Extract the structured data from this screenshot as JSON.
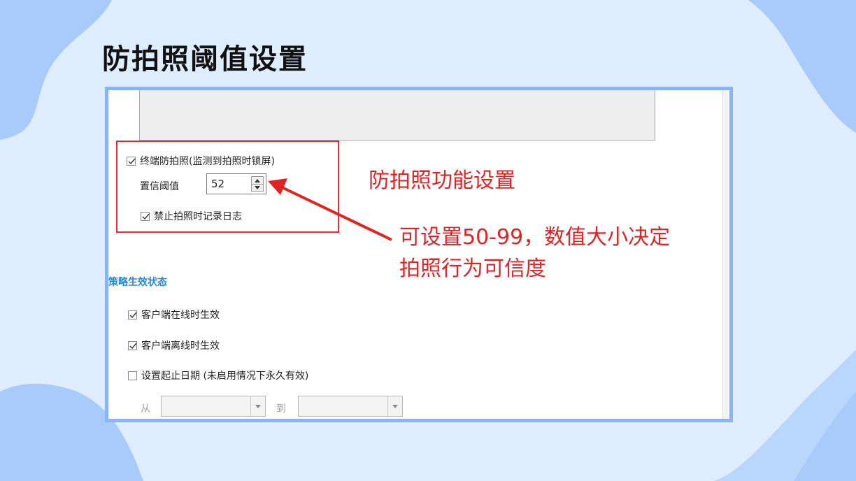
{
  "slide": {
    "title": "防拍照阈值设置"
  },
  "settings": {
    "terminal_anti_photo": {
      "label": "终端防拍照(监测到拍照时锁屏)",
      "checked": true
    },
    "confidence_threshold": {
      "label": "置信阈值",
      "value": "52"
    },
    "no_photo_log": {
      "label": "禁止拍照时记录日志",
      "checked": true
    }
  },
  "policy_status": {
    "section_title": "策略生效状态",
    "online": {
      "label": "客户端在线时生效",
      "checked": true
    },
    "offline": {
      "label": "客户端离线时生效",
      "checked": true
    },
    "date_range": {
      "label": "设置起止日期 (未启用情况下永久有效)",
      "checked": false
    },
    "from_label": "从",
    "to_label": "到",
    "from_value": "",
    "to_value": ""
  },
  "annotations": {
    "feature_label": "防拍照功能设置",
    "range_line1": "可设置50-99，数值大小决定",
    "range_line2": "拍照行为可信度"
  },
  "colors": {
    "background": "#dfeefe",
    "blob": "#a9cbfb",
    "frame_border": "#8ab4f8",
    "annotation_red": "#e02424",
    "section_blue": "#2a87d0"
  }
}
